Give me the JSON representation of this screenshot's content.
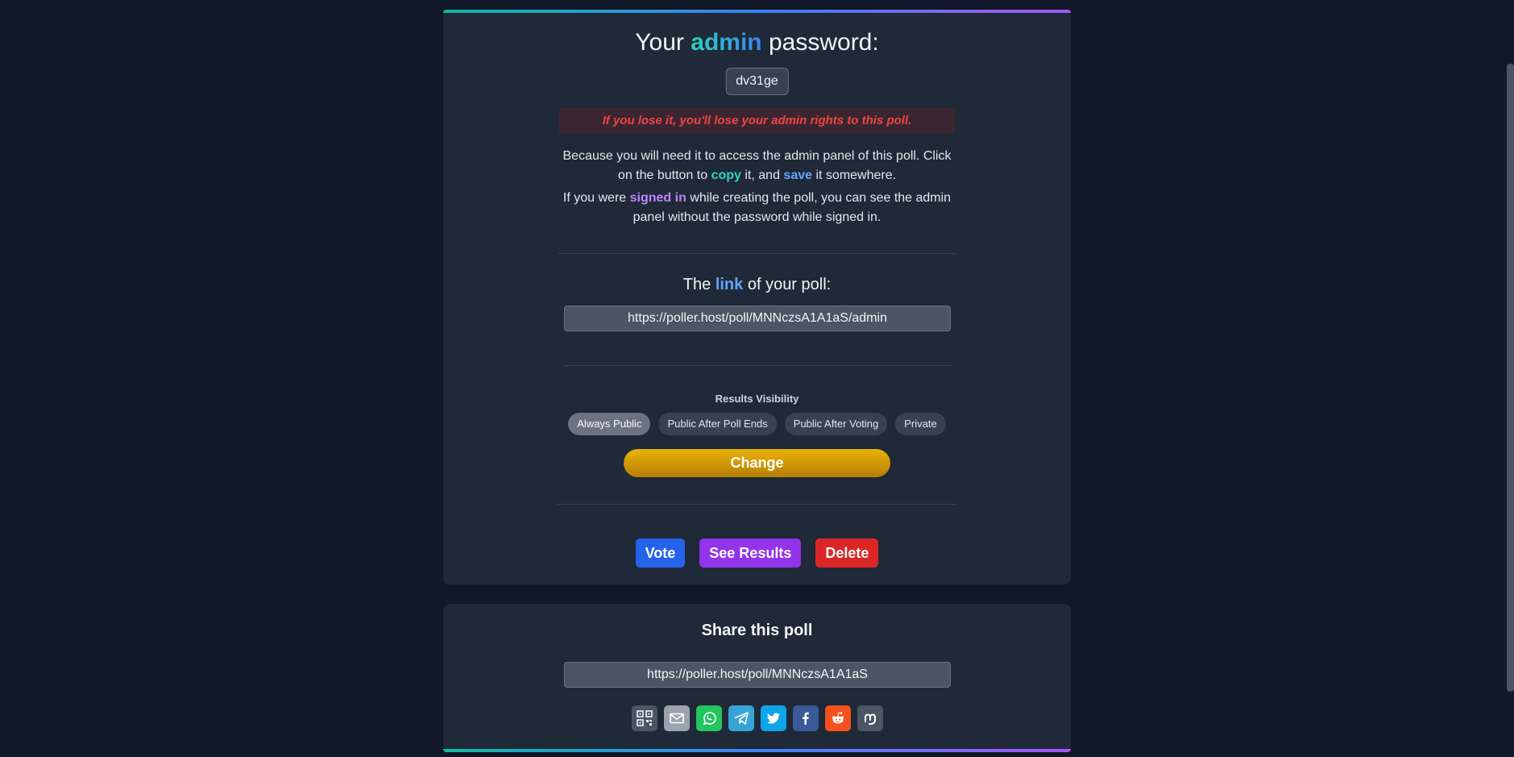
{
  "password_section": {
    "title_prefix": "Your",
    "title_highlight": "admin",
    "title_suffix": "password:",
    "password": "dv31ge",
    "warning": "If you lose it, you'll lose your admin rights to this poll.",
    "para1_a": "Because you will need it to access the admin panel of this poll. Click on the button to",
    "para1_copy": "copy",
    "para1_b": "it, and",
    "para1_save": "save",
    "para1_c": "it somewhere.",
    "para2_a": "If you were",
    "para2_signed": "signed in",
    "para2_b": "while creating the poll, you can see the admin panel without the password while signed in."
  },
  "link_section": {
    "title_prefix": "The",
    "title_highlight": "link",
    "title_suffix": "of your poll:",
    "admin_url": "https://poller.host/poll/MNNczsA1A1aS/admin"
  },
  "visibility": {
    "label": "Results Visibility",
    "options": [
      "Always Public",
      "Public After Poll Ends",
      "Public After Voting",
      "Private"
    ],
    "selected": "Always Public",
    "change_label": "Change"
  },
  "actions": {
    "vote": "Vote",
    "see_results": "See Results",
    "delete": "Delete"
  },
  "share": {
    "title": "Share this poll",
    "url": "https://poller.host/poll/MNNczsA1A1aS",
    "icons": [
      "qr-code-icon",
      "email-icon",
      "whatsapp-icon",
      "telegram-icon",
      "twitter-icon",
      "facebook-icon",
      "reddit-icon",
      "mastodon-icon"
    ]
  },
  "colors": {
    "background": "#111827",
    "card": "#1f2937",
    "vote": "#2563eb",
    "results": "#9333ea",
    "delete": "#dc2626",
    "change": "#eab308",
    "warning_text": "#ef4444"
  }
}
